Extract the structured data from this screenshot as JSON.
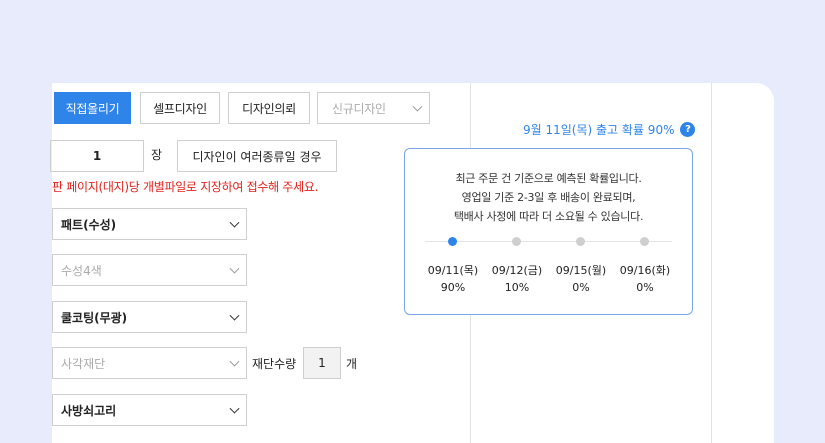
{
  "tabs": [
    {
      "label": "직접올리기",
      "active": true
    },
    {
      "label": "셀프디자인",
      "active": false
    },
    {
      "label": "디자인의뢰",
      "active": false
    },
    {
      "label": "신규디자인",
      "active": false
    }
  ],
  "quantity": {
    "value": "1",
    "unit": "장"
  },
  "multi_design_button": "디자인이 여러종류일 경우",
  "warning": "판 페이지(대지)당 개별파일로 지장하여 접수해 주세요.",
  "selects": {
    "option1": "패트(수성)",
    "option2": "수성4색",
    "option3": "쿨코팅(무광)",
    "option4": "사각재단",
    "option5": "사방쇠고리"
  },
  "cut_quantity": {
    "label": "재단수량",
    "value": "1",
    "unit": "개"
  },
  "shipping": {
    "text": "9월 11일(목) 출고 확률 90%",
    "help_icon": "?"
  },
  "popup": {
    "line1": "최근 주문 건 기준으로 예측된 확률입니다.",
    "line2": "영업일 기준 2-3일 후 배송이 완료되며,",
    "line3": "택배사 사정에 따라 더 소요될 수 있습니다.",
    "dates": [
      {
        "date": "09/11(목)",
        "prob": "90%",
        "active": true
      },
      {
        "date": "09/12(금)",
        "prob": "10%",
        "active": false
      },
      {
        "date": "09/15(월)",
        "prob": "0%",
        "active": false
      },
      {
        "date": "09/16(화)",
        "prob": "0%",
        "active": false
      }
    ]
  },
  "colors": {
    "accent": "#2f84e9",
    "warning": "#e0241e",
    "background": "#e7ebfb"
  }
}
